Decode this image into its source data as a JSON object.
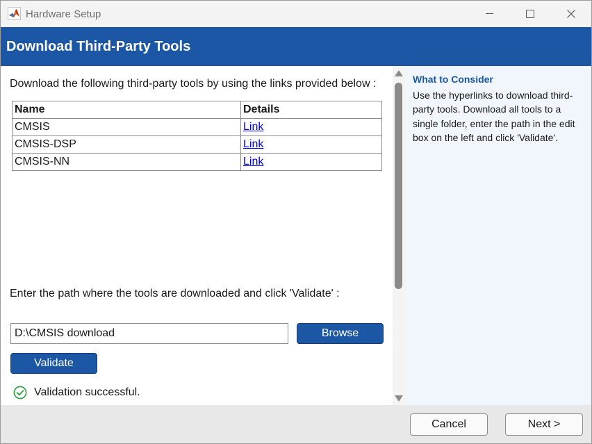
{
  "window": {
    "title": "Hardware Setup"
  },
  "header": {
    "title": "Download Third-Party Tools"
  },
  "main": {
    "instructions": "Download the following third-party tools by using the links provided below :",
    "table": {
      "columns": [
        "Name",
        "Details"
      ],
      "rows": [
        {
          "name": "CMSIS",
          "details": "Link"
        },
        {
          "name": "CMSIS-DSP",
          "details": "Link"
        },
        {
          "name": "CMSIS-NN",
          "details": "Link"
        }
      ]
    },
    "path_label": "Enter the path where the tools are downloaded and click 'Validate' :",
    "path_value": "D:\\CMSIS download",
    "browse_label": "Browse",
    "validate_label": "Validate",
    "status_text": "Validation successful."
  },
  "side": {
    "title": "What to Consider",
    "text": "Use the hyperlinks to download third-party tools. Download all tools to a single folder, enter the path in the edit box on the left and click 'Validate'."
  },
  "footer": {
    "cancel_label": "Cancel",
    "next_label": "Next >"
  },
  "icons": {
    "app": "matlab-logo-icon",
    "status": "check-circle-icon"
  },
  "colors": {
    "header_bg": "#1b57a4",
    "side_bg": "#f0f6fb",
    "side_title": "#1b57a4",
    "success_green": "#2e9e3b",
    "link": "#0000ee"
  }
}
